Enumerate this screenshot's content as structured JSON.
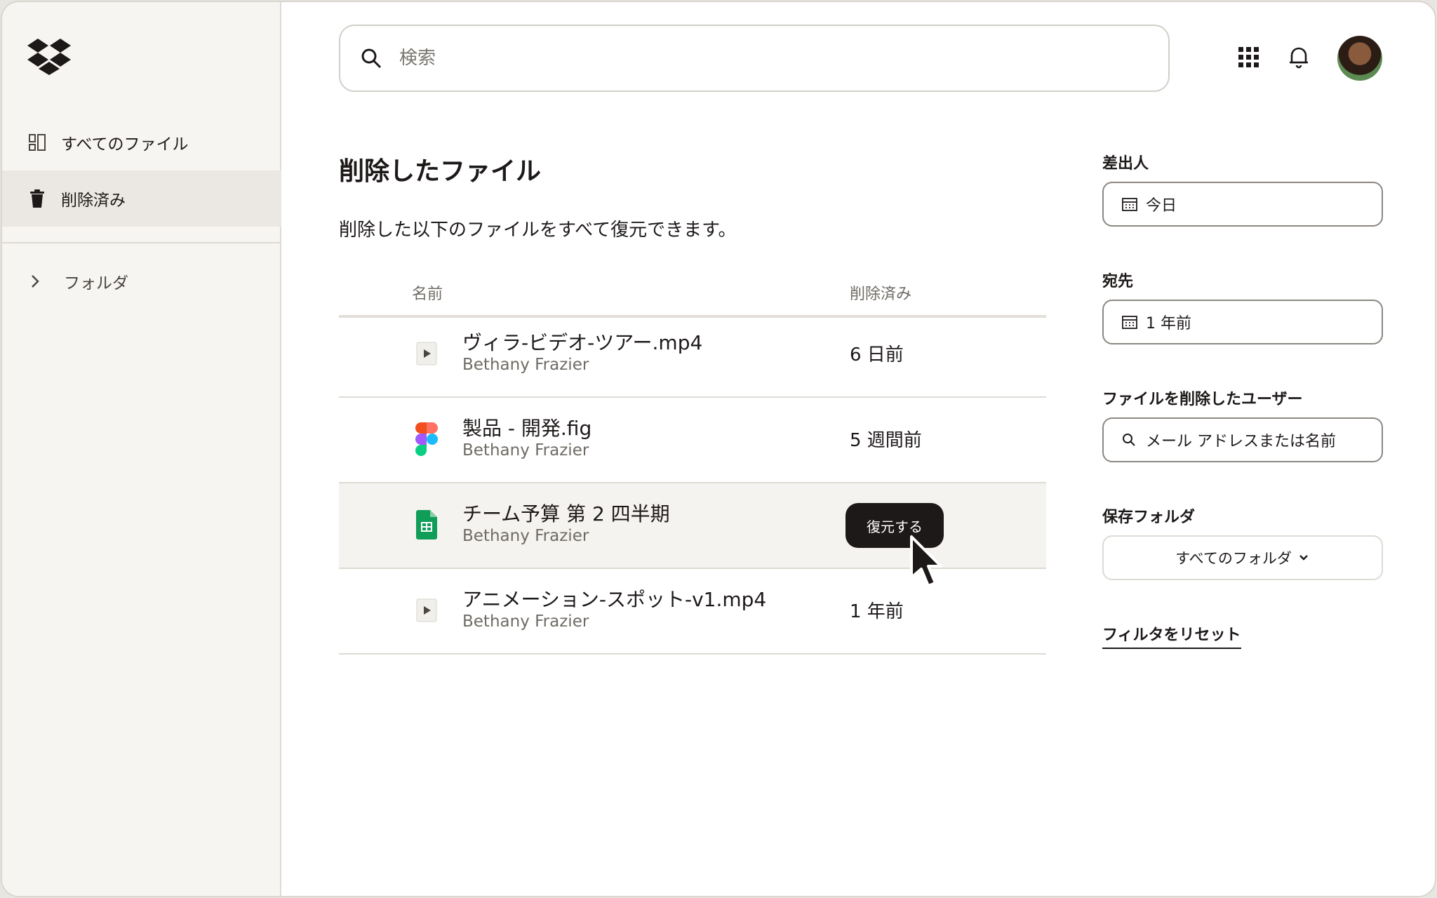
{
  "sidebar": {
    "items": [
      {
        "label": "すべてのファイル",
        "icon": "all-files-icon"
      },
      {
        "label": "削除済み",
        "icon": "trash-icon"
      }
    ],
    "folder": {
      "label": "フォルダ",
      "icon": "chevron-right-icon"
    }
  },
  "topbar": {
    "search_placeholder": "検索",
    "icons": [
      "apps-grid-icon",
      "bell-icon"
    ]
  },
  "main": {
    "title": "削除したファイル",
    "subtitle": "削除した以下のファイルをすべて復元できます。",
    "columns": {
      "name": "名前",
      "deleted": "削除済み"
    },
    "rows": [
      {
        "name": "ヴィラ-ビデオ-ツアー.mp4",
        "owner": "Bethany Frazier",
        "deleted": "6 日前",
        "icon": "video-file-icon"
      },
      {
        "name": "製品 - 開発.fig",
        "owner": "Bethany Frazier",
        "deleted": "5 週間前",
        "icon": "figma-file-icon"
      },
      {
        "name": "チーム予算 第 2 四半期",
        "owner": "Bethany Frazier",
        "deleted": "",
        "icon": "sheets-file-icon",
        "action": "復元する"
      },
      {
        "name": "アニメーション-スポット-v1.mp4",
        "owner": "Bethany Frazier",
        "deleted": "1 年前",
        "icon": "video-file-icon"
      }
    ]
  },
  "filters": {
    "from": {
      "label": "差出人",
      "value": "今日"
    },
    "to": {
      "label": "宛先",
      "value": "1 年前"
    },
    "user": {
      "label": "ファイルを削除したユーザー",
      "placeholder": "メール アドレスまたは名前"
    },
    "folder": {
      "label": "保存フォルダ",
      "value": "すべてのフォルダ"
    },
    "reset": "フィルタをリセット"
  },
  "colors": {
    "accent_dark": "#1e1919",
    "sidebar_bg": "#f7f5f2",
    "sheets_green": "#0f9d58"
  }
}
